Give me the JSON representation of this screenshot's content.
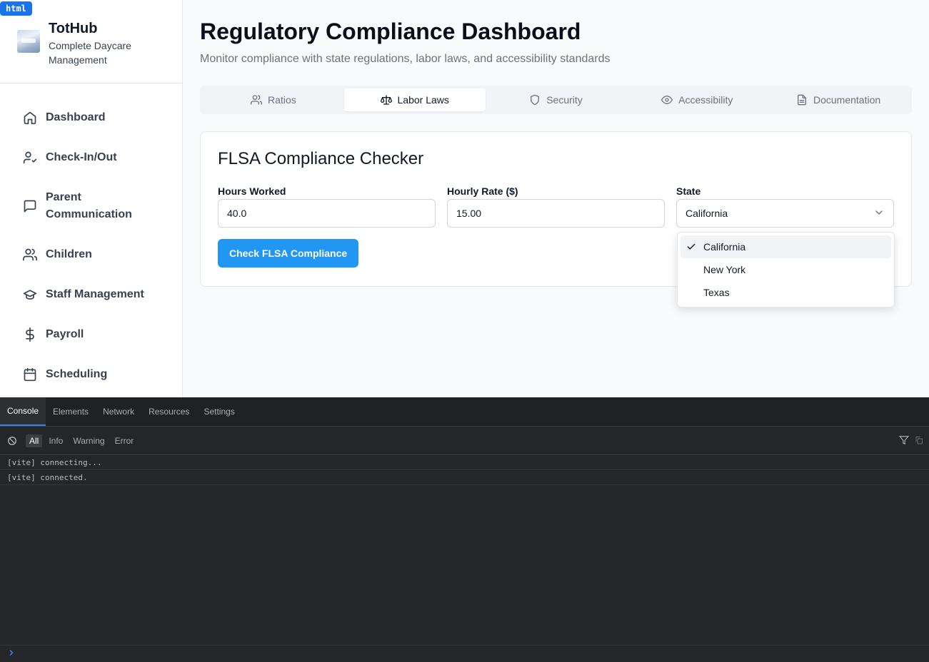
{
  "badge": "html",
  "brand": {
    "name": "TotHub",
    "subtitle": "Complete Daycare Management"
  },
  "nav": [
    {
      "label": "Dashboard",
      "icon": "home-icon"
    },
    {
      "label": "Check-In/Out",
      "icon": "user-check-icon"
    },
    {
      "label": "Parent Communication",
      "icon": "message-square-icon"
    },
    {
      "label": "Children",
      "icon": "users-icon"
    },
    {
      "label": "Staff Management",
      "icon": "graduation-cap-icon"
    },
    {
      "label": "Payroll",
      "icon": "dollar-sign-icon"
    },
    {
      "label": "Scheduling",
      "icon": "calendar-icon"
    }
  ],
  "page": {
    "title": "Regulatory Compliance Dashboard",
    "subtitle": "Monitor compliance with state regulations, labor laws, and accessibility standards"
  },
  "tabs": [
    {
      "label": "Ratios",
      "icon": "users-icon",
      "active": false
    },
    {
      "label": "Labor Laws",
      "icon": "scale-icon",
      "active": true
    },
    {
      "label": "Security",
      "icon": "shield-icon",
      "active": false
    },
    {
      "label": "Accessibility",
      "icon": "eye-icon",
      "active": false
    },
    {
      "label": "Documentation",
      "icon": "file-text-icon",
      "active": false
    }
  ],
  "card": {
    "title": "FLSA Compliance Checker",
    "hours_label": "Hours Worked",
    "hours_value": "40.0",
    "rate_label": "Hourly Rate ($)",
    "rate_value": "15.00",
    "state_label": "State",
    "state_value": "California",
    "button": "Check FLSA Compliance"
  },
  "state_options": [
    {
      "label": "California",
      "selected": true
    },
    {
      "label": "New York",
      "selected": false
    },
    {
      "label": "Texas",
      "selected": false
    }
  ],
  "devtools": {
    "tabs": [
      "Console",
      "Elements",
      "Network",
      "Resources",
      "Settings"
    ],
    "active_tab": "Console",
    "filters": [
      "All",
      "Info",
      "Warning",
      "Error"
    ],
    "active_filter": "All",
    "logs": [
      "[vite] connecting...",
      "[vite] connected."
    ]
  },
  "colors": {
    "primary": "#2196f3",
    "devtools_bg": "#242629"
  }
}
